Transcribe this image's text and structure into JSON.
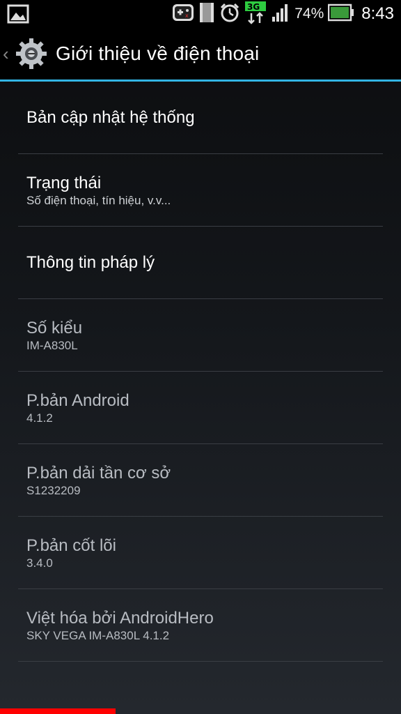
{
  "status_bar": {
    "battery_percent": "74%",
    "time": "8:43",
    "network_type": "3G",
    "icons": [
      "image-icon",
      "game-controller-icon",
      "sim-icon",
      "alarm-icon",
      "network-3g-icon",
      "signal-icon",
      "battery-icon"
    ]
  },
  "action_bar": {
    "title": "Giới thiệu về điện thoại",
    "icon": "settings-gear-icon"
  },
  "items": [
    {
      "title": "Bản cập nhật hệ thống",
      "subtitle": ""
    },
    {
      "title": "Trạng thái",
      "subtitle": "Số điện thoại, tín hiệu, v.v..."
    },
    {
      "title": "Thông tin pháp lý",
      "subtitle": ""
    },
    {
      "title": "Số kiểu",
      "subtitle": "IM-A830L"
    },
    {
      "title": "P.bản Android",
      "subtitle": "4.1.2"
    },
    {
      "title": "P.bản dải tần cơ sở",
      "subtitle": "S1232209"
    },
    {
      "title": "P.bản cốt lõi",
      "subtitle": "3.4.0"
    },
    {
      "title": "Việt hóa bởi AndroidHero",
      "subtitle": "SKY VEGA IM-A830L 4.1.2"
    }
  ],
  "colors": {
    "accent": "#33b5e5",
    "divider": "#3a3e44",
    "bottom_indicator": "#ff0000"
  }
}
